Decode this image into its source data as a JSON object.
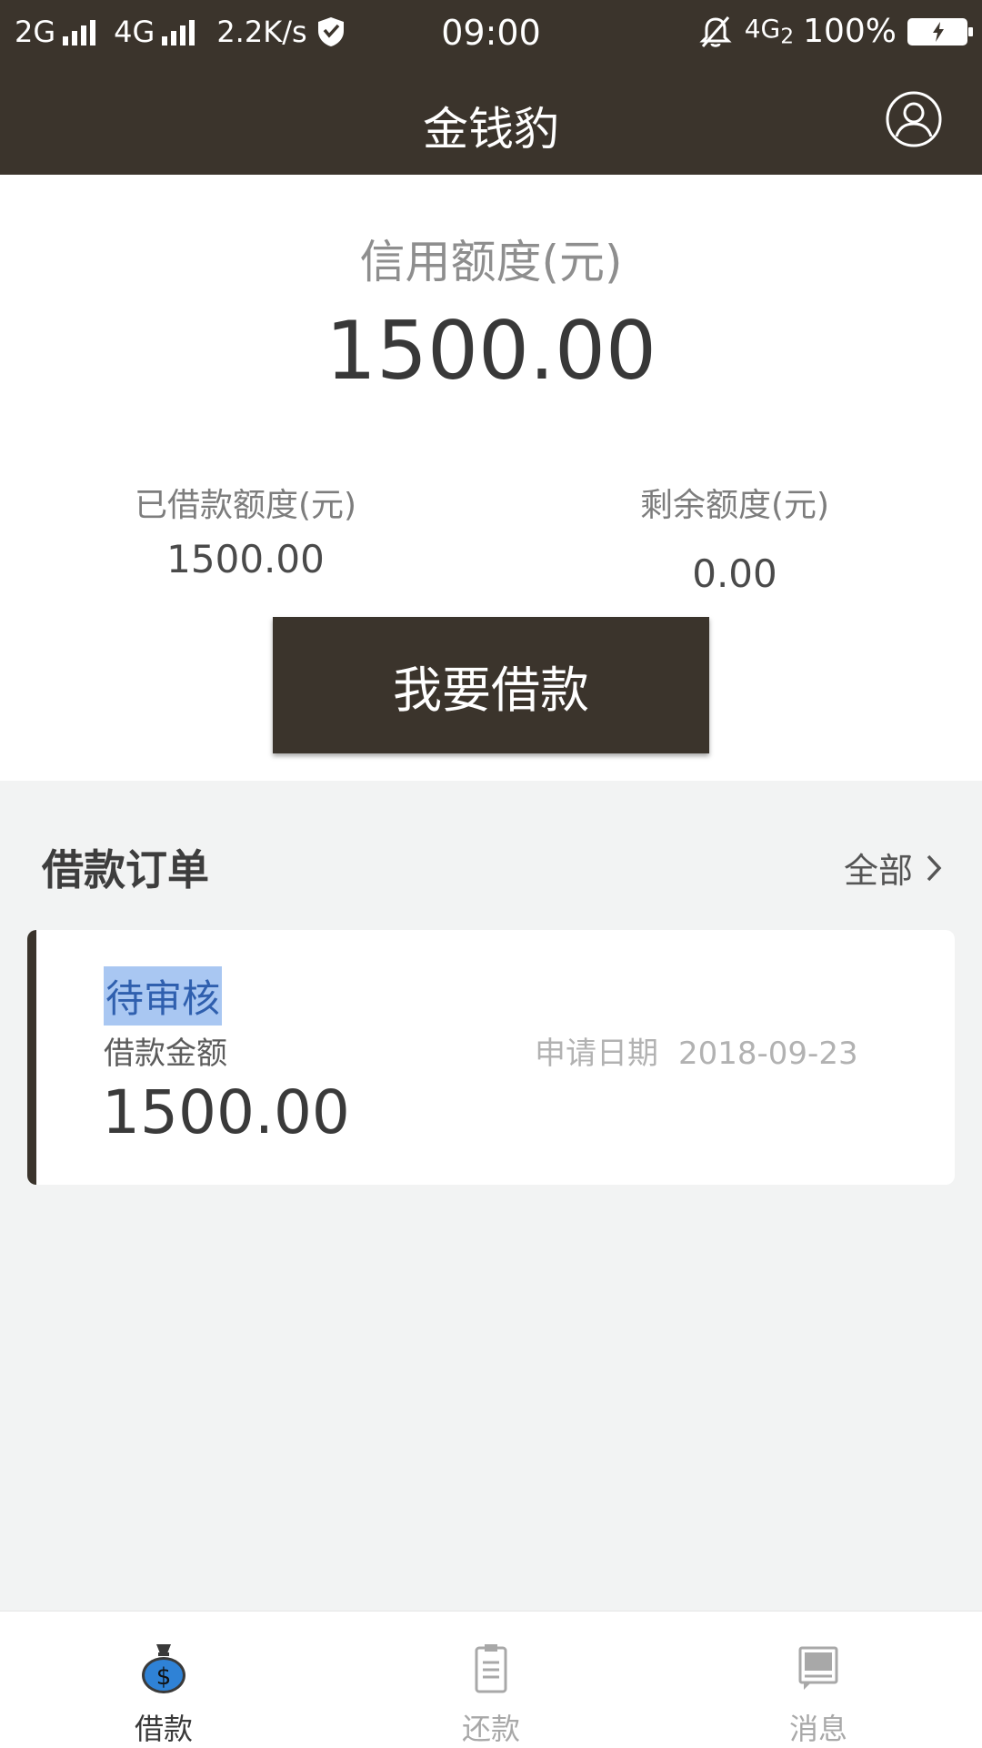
{
  "status_bar": {
    "net1": "2G",
    "net2": "4G",
    "speed": "2.2K/s",
    "time": "09:00",
    "net3": "4G",
    "net3_sub": "2",
    "battery": "100%"
  },
  "header": {
    "title": "金钱豹"
  },
  "credit": {
    "label": "信用额度(元)",
    "value": "1500.00",
    "borrowed_label": "已借款额度(元)",
    "borrowed_value": "1500.00",
    "remaining_label": "剩余额度(元)",
    "remaining_value": "0.00",
    "borrow_button": "我要借款"
  },
  "orders": {
    "title": "借款订单",
    "all_link": "全部",
    "items": [
      {
        "status": "待审核",
        "amount_label": "借款金额",
        "amount": "1500.00",
        "date_label": "申请日期",
        "date": "2018-09-23"
      }
    ]
  },
  "nav": {
    "items": [
      {
        "label": "借款",
        "icon": "money-bag-icon",
        "active": true
      },
      {
        "label": "还款",
        "icon": "clipboard-icon",
        "active": false
      },
      {
        "label": "消息",
        "icon": "message-icon",
        "active": false
      }
    ]
  },
  "colors": {
    "header_bg": "#3b342c",
    "page_bg": "#f2f3f3",
    "selection": "#a9c7f2",
    "nav_active_icon": "#2f82d6"
  }
}
